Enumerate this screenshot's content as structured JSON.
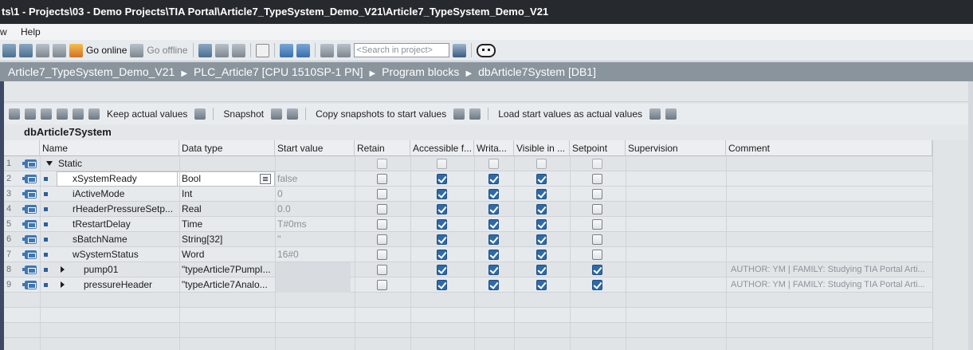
{
  "window": {
    "title": "ts\\1 - Projects\\03 - Demo Projects\\TIA Portal\\Article7_TypeSystem_Demo_V21\\Article7_TypeSystem_Demo_V21"
  },
  "menu": {
    "items": [
      "w",
      "Help"
    ]
  },
  "toolbar": {
    "go_online": "Go online",
    "go_offline": "Go offline",
    "search_placeholder": "<Search in project>"
  },
  "breadcrumb": {
    "items": [
      "Article7_TypeSystem_Demo_V21",
      "PLC_Article7 [CPU 1510SP-1 PN]",
      "Program blocks",
      "dbArticle7System [DB1]"
    ]
  },
  "block_toolbar": {
    "keep_actual_values": "Keep actual values",
    "snapshot": "Snapshot",
    "copy_snapshots": "Copy snapshots to start values",
    "load_start_values": "Load start values as actual values"
  },
  "db": {
    "title": "dbArticle7System"
  },
  "table": {
    "headers": [
      "Name",
      "Data type",
      "Start value",
      "Retain",
      "Accessible f...",
      "Writa...",
      "Visible in ...",
      "Setpoint",
      "Supervision",
      "Comment"
    ],
    "rows": [
      {
        "num": "1",
        "name": "Static",
        "type": "",
        "start": "",
        "retain": false,
        "accessible": false,
        "writable": false,
        "visible": false,
        "setpoint": false,
        "comment": ""
      },
      {
        "num": "2",
        "name": "xSystemReady",
        "type": "Bool",
        "start": "false",
        "retain": false,
        "accessible": true,
        "writable": true,
        "visible": true,
        "setpoint": false,
        "comment": ""
      },
      {
        "num": "3",
        "name": "iActiveMode",
        "type": "Int",
        "start": "0",
        "retain": false,
        "accessible": true,
        "writable": true,
        "visible": true,
        "setpoint": false,
        "comment": ""
      },
      {
        "num": "4",
        "name": "rHeaderPressureSetp...",
        "type": "Real",
        "start": "0.0",
        "retain": false,
        "accessible": true,
        "writable": true,
        "visible": true,
        "setpoint": false,
        "comment": ""
      },
      {
        "num": "5",
        "name": "tRestartDelay",
        "type": "Time",
        "start": "T#0ms",
        "retain": false,
        "accessible": true,
        "writable": true,
        "visible": true,
        "setpoint": false,
        "comment": ""
      },
      {
        "num": "6",
        "name": "sBatchName",
        "type": "String[32]",
        "start": "''",
        "retain": false,
        "accessible": true,
        "writable": true,
        "visible": true,
        "setpoint": false,
        "comment": ""
      },
      {
        "num": "7",
        "name": "wSystemStatus",
        "type": "Word",
        "start": "16#0",
        "retain": false,
        "accessible": true,
        "writable": true,
        "visible": true,
        "setpoint": false,
        "comment": ""
      },
      {
        "num": "8",
        "name": "pump01",
        "type": "\"typeArticle7PumpI...",
        "start": "",
        "retain": false,
        "accessible": true,
        "writable": true,
        "visible": true,
        "setpoint": true,
        "comment": "AUTHOR: YM | FAMILY: Studying TIA Portal Arti..."
      },
      {
        "num": "9",
        "name": "pressureHeader",
        "type": "\"typeArticle7Analo...",
        "start": "",
        "retain": false,
        "accessible": true,
        "writable": true,
        "visible": true,
        "setpoint": true,
        "comment": "AUTHOR: YM | FAMILY: Studying TIA Portal Arti..."
      }
    ]
  },
  "icons": [
    "save-project-icon",
    "go-online-icon",
    "go-offline-icon",
    "search-icon",
    "robot-icon",
    "db-member-icon",
    "expand-icon",
    "collapse-icon",
    "datatype-select-icon"
  ],
  "colors": {
    "titlebar": "#262a2f",
    "breadcrumb": "#8a949d",
    "checkbox_on": "#2e6aa8",
    "db_icon": "#3f76b5"
  }
}
